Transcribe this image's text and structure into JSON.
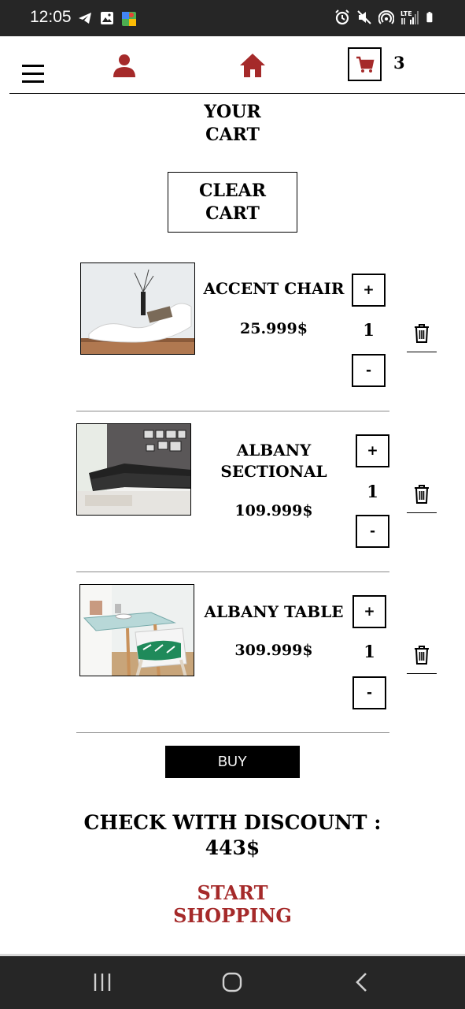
{
  "status_bar": {
    "time": "12:05"
  },
  "nav": {
    "cart_count": "3"
  },
  "title": "YOUR\nCART",
  "clear_button": "CLEAR\nCART",
  "items": [
    {
      "name": "ACCENT CHAIR",
      "price": "25.999$",
      "qty": "1",
      "plus": "+",
      "minus": "-"
    },
    {
      "name": "ALBANY\nSECTIONAL",
      "price": "109.999$",
      "qty": "1",
      "plus": "+",
      "minus": "-"
    },
    {
      "name": "ALBANY TABLE",
      "price": "309.999$",
      "qty": "1",
      "plus": "+",
      "minus": "-"
    }
  ],
  "buy_button": "BUY",
  "total": "CHECK WITH DISCOUNT :\n443$",
  "start_shopping": "START\nSHOPPING",
  "colors": {
    "accent": "#a52a2a",
    "status_bar": "#262626"
  }
}
